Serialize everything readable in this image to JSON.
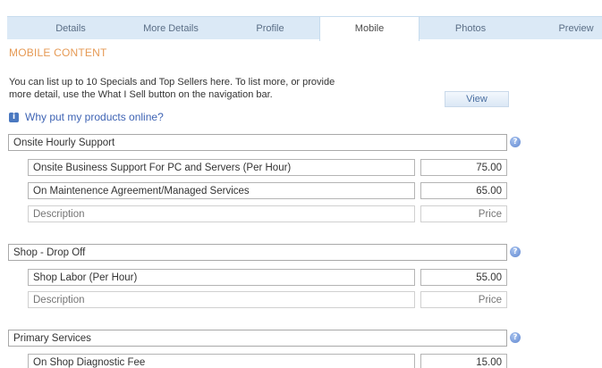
{
  "tabs": [
    {
      "label": "Details"
    },
    {
      "label": "More Details"
    },
    {
      "label": "Profile"
    },
    {
      "label": "Mobile"
    },
    {
      "label": "Photos"
    },
    {
      "label": "Preview"
    }
  ],
  "active_tab": "Mobile",
  "section_title": "MOBILE CONTENT",
  "intro": {
    "line1": "You can list up to 10 Specials and Top Sellers here. To list more, or provide",
    "line2": "more detail, use the What I Sell button on the navigation bar."
  },
  "view_button": "View",
  "why_link": "Why put my products online?",
  "icons": {
    "info": "info-icon",
    "help": "question-mark-icon"
  },
  "colors": {
    "accent": "#e69a55",
    "tab_bar": "#dbe9f6",
    "link": "#3f64b4"
  },
  "groups": [
    {
      "name": "Onsite Hourly Support",
      "items": [
        {
          "description": "Onsite Business Support For PC and Servers (Per Hour)",
          "price": "75.00"
        },
        {
          "description": "On Maintenence Agreement/Managed Services",
          "price": "65.00"
        },
        {
          "description": "",
          "price": ""
        }
      ]
    },
    {
      "name": "Shop - Drop Off",
      "items": [
        {
          "description": "Shop Labor (Per Hour)",
          "price": "55.00"
        },
        {
          "description": "",
          "price": ""
        }
      ]
    },
    {
      "name": "Primary Services",
      "items": [
        {
          "description": "On Shop Diagnostic Fee",
          "price": "15.00"
        }
      ]
    }
  ],
  "placeholders": {
    "description": "Description",
    "price": "Price"
  }
}
